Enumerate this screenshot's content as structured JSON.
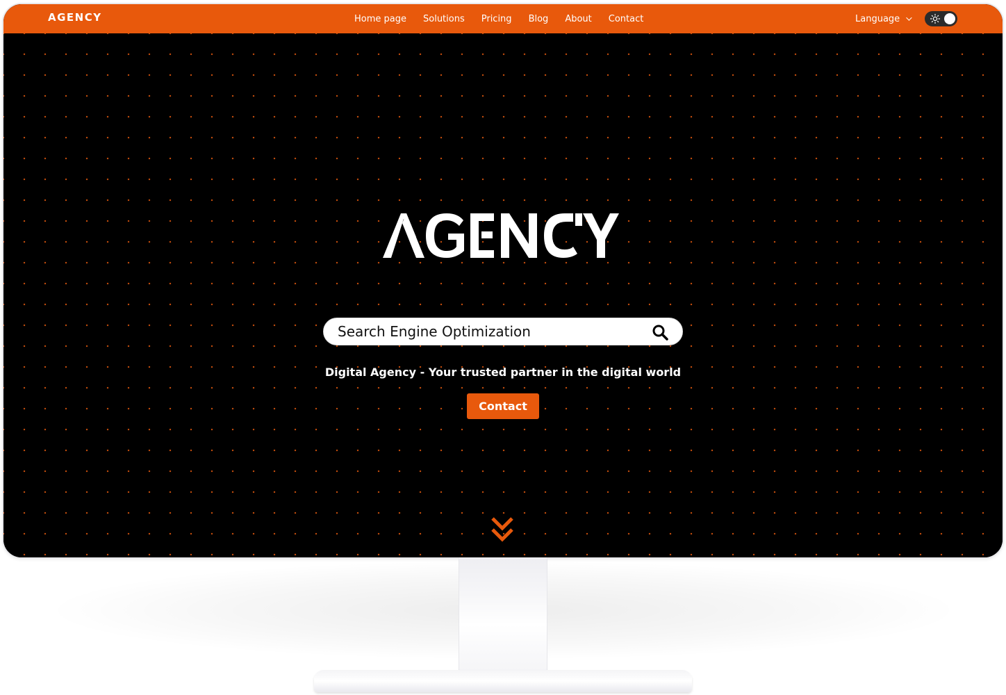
{
  "navbar": {
    "logo": "AGENCY",
    "links": [
      "Home page",
      "Solutions",
      "Pricing",
      "Blog",
      "About",
      "Contact"
    ],
    "language_label": "Language",
    "theme_toggle_icon": "sun-icon"
  },
  "hero": {
    "logo": "AGENCY",
    "search": {
      "value": "Search Engine Optimization",
      "icon": "search-icon"
    },
    "tagline": "Digital Agency - Your trusted partner in the digital world",
    "contact_label": "Contact",
    "scroll_icon": "double-chevron-down-icon"
  },
  "colors": {
    "accent": "#e8590c",
    "background": "#000000",
    "text": "#ffffff"
  }
}
